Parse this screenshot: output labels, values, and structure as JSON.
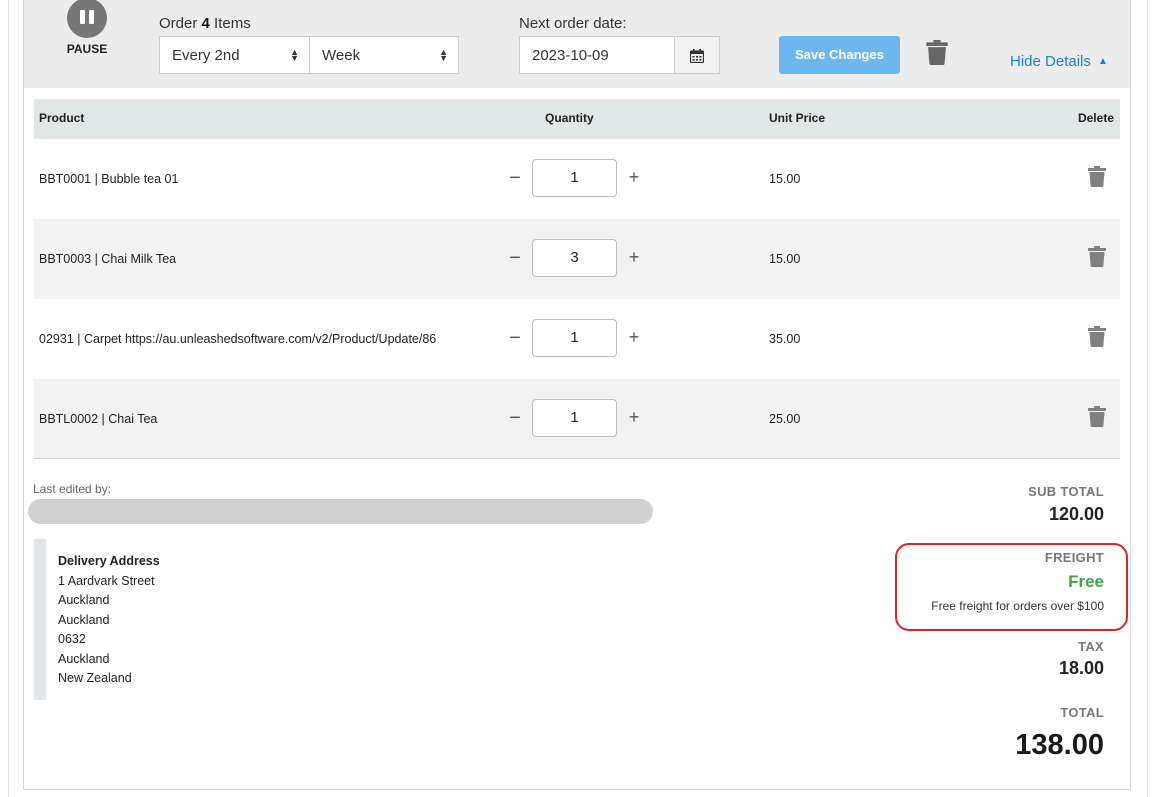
{
  "pause": {
    "label": "PAUSE"
  },
  "order": {
    "prefix": "Order",
    "count": "4",
    "suffix": "Items"
  },
  "frequency": {
    "interval": "Every 2nd",
    "unit": "Week"
  },
  "next_order": {
    "label": "Next order date:",
    "value": "2023-10-09"
  },
  "actions": {
    "save_label": "Save Changes",
    "hide_details_label": "Hide Details"
  },
  "table": {
    "headers": {
      "product": "Product",
      "quantity": "Quantity",
      "unit_price": "Unit Price",
      "delete": "Delete"
    },
    "rows": [
      {
        "product": "BBT0001 | Bubble tea 01",
        "quantity": "1",
        "unit_price": "15.00"
      },
      {
        "product": "BBT0003 | Chai Milk Tea",
        "quantity": "3",
        "unit_price": "15.00"
      },
      {
        "product": "02931 | Carpet https://au.unleashedsoftware.com/v2/Product/Update/86",
        "quantity": "1",
        "unit_price": "35.00"
      },
      {
        "product": "BBTL0002 | Chai Tea",
        "quantity": "1",
        "unit_price": "25.00"
      }
    ]
  },
  "last_edited": {
    "label": "Last edited by:"
  },
  "delivery": {
    "title": "Delivery Address",
    "lines": [
      "1 Aardvark Street",
      "Auckland",
      "Auckland",
      "0632",
      "Auckland",
      "New Zealand"
    ]
  },
  "summary": {
    "subtotal_label": "SUB TOTAL",
    "subtotal_value": "120.00",
    "freight_label": "FREIGHT",
    "freight_value": "Free",
    "freight_note": "Free freight for orders over $100",
    "tax_label": "TAX",
    "tax_value": "18.00",
    "total_label": "TOTAL",
    "total_value": "138.00"
  },
  "colors": {
    "accent_blue": "#6cb7f0",
    "link_blue": "#1a7fd6",
    "free_green": "#3aa83d",
    "highlight_red": "#e02424"
  },
  "icons": {
    "pause": "pause-icon",
    "calendar": "calendar-icon",
    "trash": "trash-icon",
    "caret_up": "caret-up-icon",
    "select_arrows": "select-arrows-icon"
  }
}
